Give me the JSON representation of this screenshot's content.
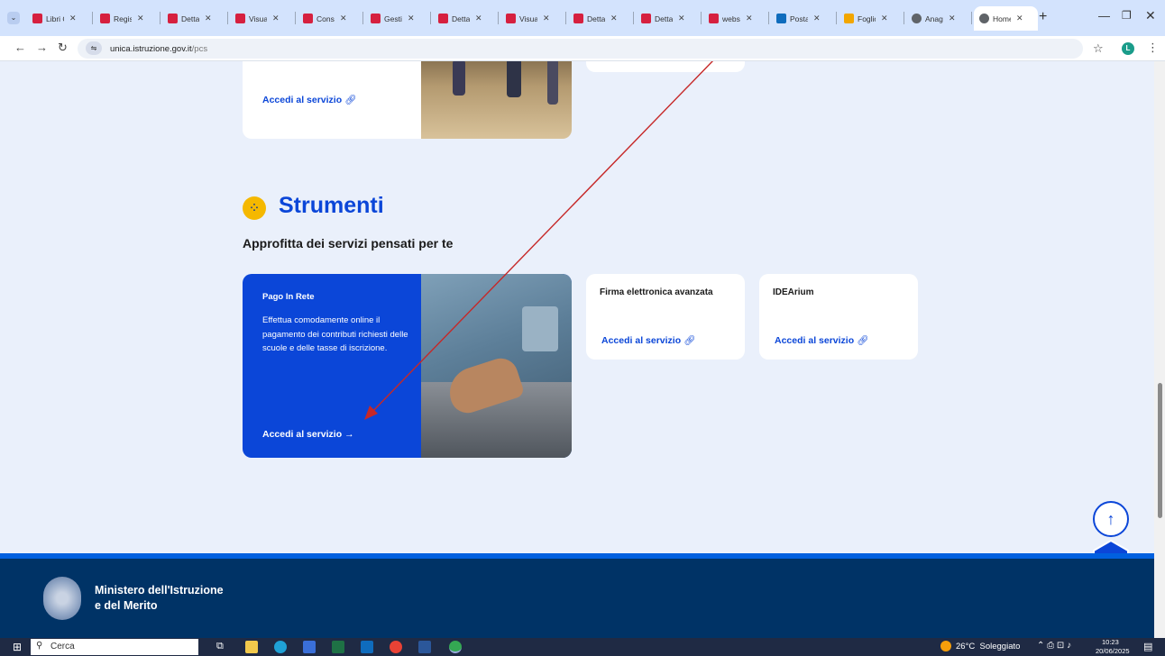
{
  "browser": {
    "tabs": [
      {
        "label": "Libri C"
      },
      {
        "label": "Regis"
      },
      {
        "label": "Detta"
      },
      {
        "label": "Visual"
      },
      {
        "label": "Consu"
      },
      {
        "label": "Gestic"
      },
      {
        "label": "Detta"
      },
      {
        "label": "Visual"
      },
      {
        "label": "Detta"
      },
      {
        "label": "Detta"
      },
      {
        "label": "webs"
      },
      {
        "label": "Posta"
      },
      {
        "label": "Foglio"
      },
      {
        "label": "Anag"
      },
      {
        "label": "Home"
      }
    ],
    "url_host": "unica.istruzione.gov.it",
    "url_path": "/pcs",
    "profile_initial": "L"
  },
  "top_card": {
    "link": "Accedi al servizio"
  },
  "section": {
    "title": "Strumenti",
    "subtitle": "Approfitta dei servizi pensati per te"
  },
  "featured": {
    "title": "Pago In Rete",
    "description": "Effettua comodamente online il pagamento dei contributi richiesti delle scuole e delle tasse di iscrizione.",
    "link": "Accedi al servizio",
    "link_arrow": "→"
  },
  "cards": [
    {
      "title": "Firma elettronica avanzata",
      "link": "Accedi al servizio"
    },
    {
      "title": "IDEArium",
      "link": "Accedi al servizio"
    }
  ],
  "footer": {
    "line1": "Ministero dell'Istruzione",
    "line2": "e del Merito"
  },
  "taskbar": {
    "search": "Cerca",
    "weather": "26°C  Soleggiato",
    "time": "10:23",
    "date": "20/06/2025"
  },
  "colors": {
    "primary": "#0b46d8",
    "footer": "#003366",
    "accent_icon": "#f5b800"
  }
}
